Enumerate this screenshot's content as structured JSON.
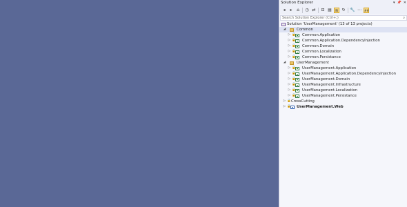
{
  "panel": {
    "title": "Solution Explorer",
    "controls": {
      "pin": "📌",
      "close": "✕",
      "menu": "▾"
    },
    "search_placeholder": "Search Solution Explorer (Ctrl+;)",
    "toolbar": {
      "active_icon_label": "##"
    }
  },
  "tree": {
    "solution": "Solution 'UserManagement' (13 of 13 projects)",
    "common_folder": "Common",
    "common_projects": [
      "Common.Application",
      "Common.Application.DependencyInjection",
      "Common.Domain",
      "Common.Localization",
      "Common.Persistance"
    ],
    "usermanagement_folder": "UserManagement",
    "usermanagement_projects": [
      "UserManagement.Application",
      "UserManagement.Application.DependencyInjection",
      "UserManagement.Domain",
      "UserManagement.Infrastructure",
      "UserManagement.Localization",
      "UserManagement.Persistance"
    ],
    "crosscutting_folder": "CrossCutting",
    "web_project": "UserManagement.Web"
  },
  "colors": {
    "editor_background": "#5a6896",
    "selection": "#dde2f3",
    "active_button": "#f4d88a"
  }
}
